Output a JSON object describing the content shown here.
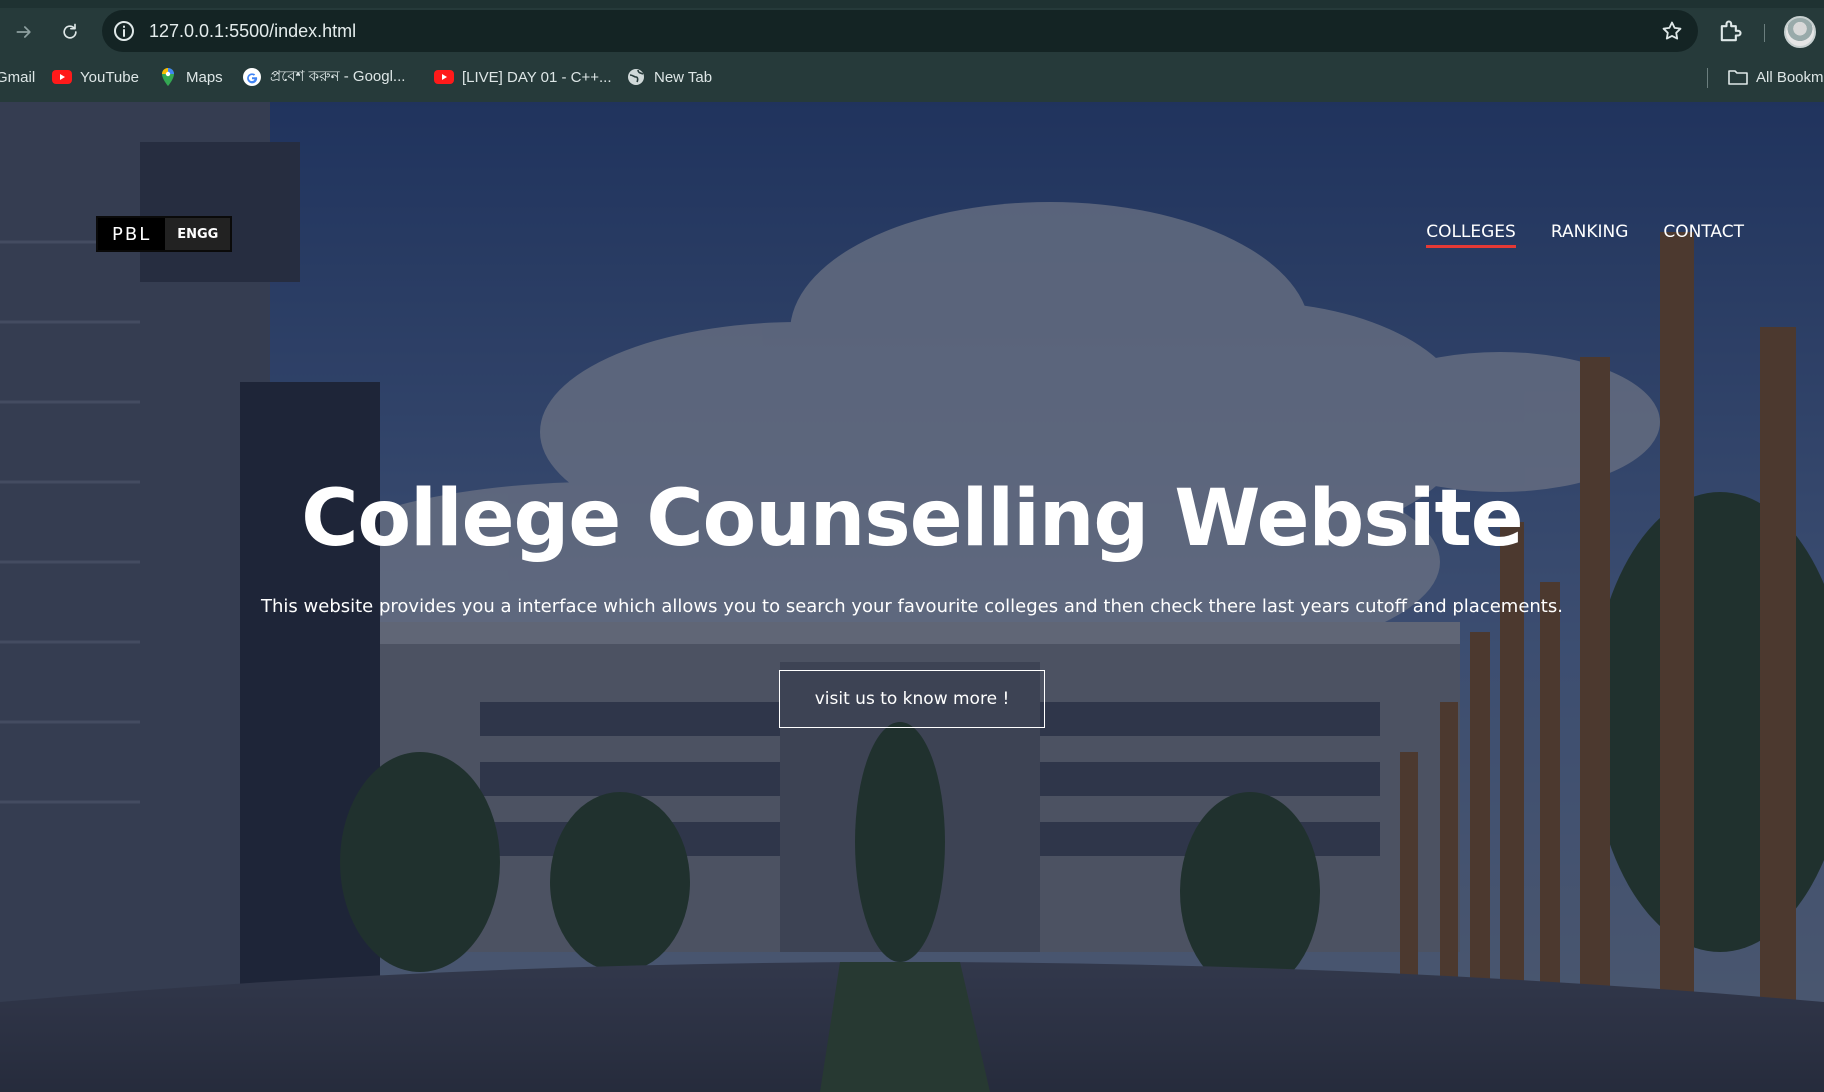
{
  "browser": {
    "url": "127.0.0.1:5500/index.html",
    "bookmarks": [
      {
        "label": "Gmail",
        "icon": "gmail-icon"
      },
      {
        "label": "YouTube",
        "icon": "youtube-icon"
      },
      {
        "label": "Maps",
        "icon": "maps-icon"
      },
      {
        "label": "প্রবেশ করুন - Googl...",
        "icon": "google-icon"
      },
      {
        "label": "[LIVE] DAY 01 - C++...",
        "icon": "youtube-icon"
      },
      {
        "label": "New Tab",
        "icon": "globe-icon"
      }
    ],
    "all_bookmarks_label": "All Bookm"
  },
  "site": {
    "logo_left": "PBL",
    "logo_right": "ENGG",
    "nav": [
      {
        "label": "COLLEGES",
        "active": true
      },
      {
        "label": "RANKING",
        "active": false
      },
      {
        "label": "CONTACT",
        "active": false
      }
    ],
    "hero_title": "College Counselling Website",
    "hero_subtitle": "This website provides you a interface which allows you to search your favourite colleges and then check there last years cutoff and placements.",
    "hero_button": "visit us to know more !",
    "accent_color": "#e53935"
  }
}
